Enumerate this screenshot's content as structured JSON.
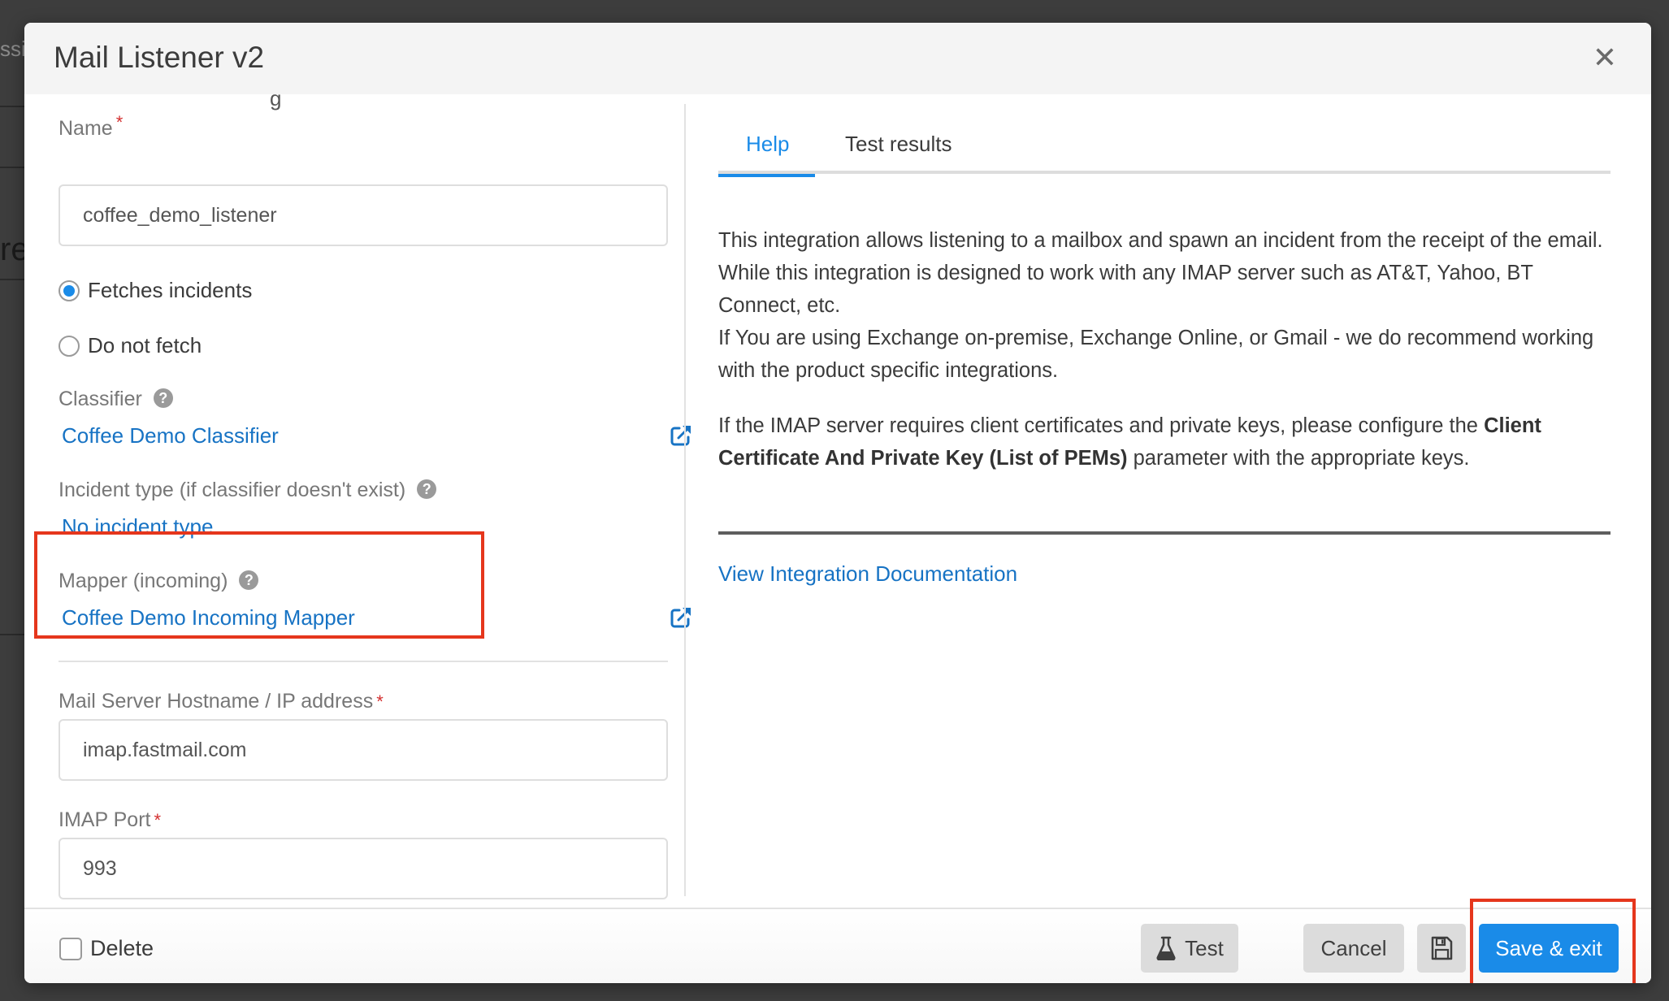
{
  "background": {
    "partial_texts": [
      "ssi",
      "re"
    ]
  },
  "modal": {
    "title": "Mail Listener v2",
    "close_icon": "close-icon"
  },
  "form": {
    "cutoff_label": "g",
    "name": {
      "label": "Name",
      "required_mark": "*",
      "value": "coffee_demo_listener"
    },
    "fetch_options": [
      {
        "label": "Fetches incidents",
        "checked": true
      },
      {
        "label": "Do not fetch",
        "checked": false
      }
    ],
    "classifier": {
      "label": "Classifier",
      "help_icon": "?",
      "value": "Coffee Demo Classifier"
    },
    "incident_type": {
      "label": "Incident type (if classifier doesn't exist)",
      "help_icon": "?",
      "value": "No incident type"
    },
    "mapper": {
      "label": "Mapper (incoming)",
      "help_icon": "?",
      "value": "Coffee Demo Incoming Mapper"
    },
    "hostname": {
      "label": "Mail Server Hostname / IP address",
      "required_mark": "*",
      "value": "imap.fastmail.com"
    },
    "port": {
      "label": "IMAP Port",
      "required_mark": "*",
      "value": "993"
    }
  },
  "right_panel": {
    "tabs": [
      {
        "label": "Help",
        "active": true
      },
      {
        "label": "Test results",
        "active": false
      }
    ],
    "help": {
      "para1_line1": "This integration allows listening to a mailbox and spawn an incident from the receipt of the email.",
      "para1_line2": "While this integration is designed to work with any IMAP server such as AT&T, Yahoo, BT Connect, etc.",
      "para1_line3": "If You are using Exchange on-premise, Exchange Online, or Gmail - we do recommend working with the product specific integrations.",
      "para2_prefix": "If the IMAP server requires client certificates and private keys, please configure the ",
      "para2_bold": "Client Certificate And Private Key (List of PEMs)",
      "para2_suffix": " parameter with the appropriate keys."
    },
    "doc_link": "View Integration Documentation"
  },
  "footer": {
    "delete_label": "Delete",
    "delete_checked": false,
    "test_label": "Test",
    "cancel_label": "Cancel",
    "save_icon": "floppy-disk-icon",
    "save_exit_label": "Save & exit"
  },
  "colors": {
    "accent": "#1a8be8",
    "link": "#1773c4",
    "required": "#d32f2f",
    "highlight": "#e5361c"
  }
}
